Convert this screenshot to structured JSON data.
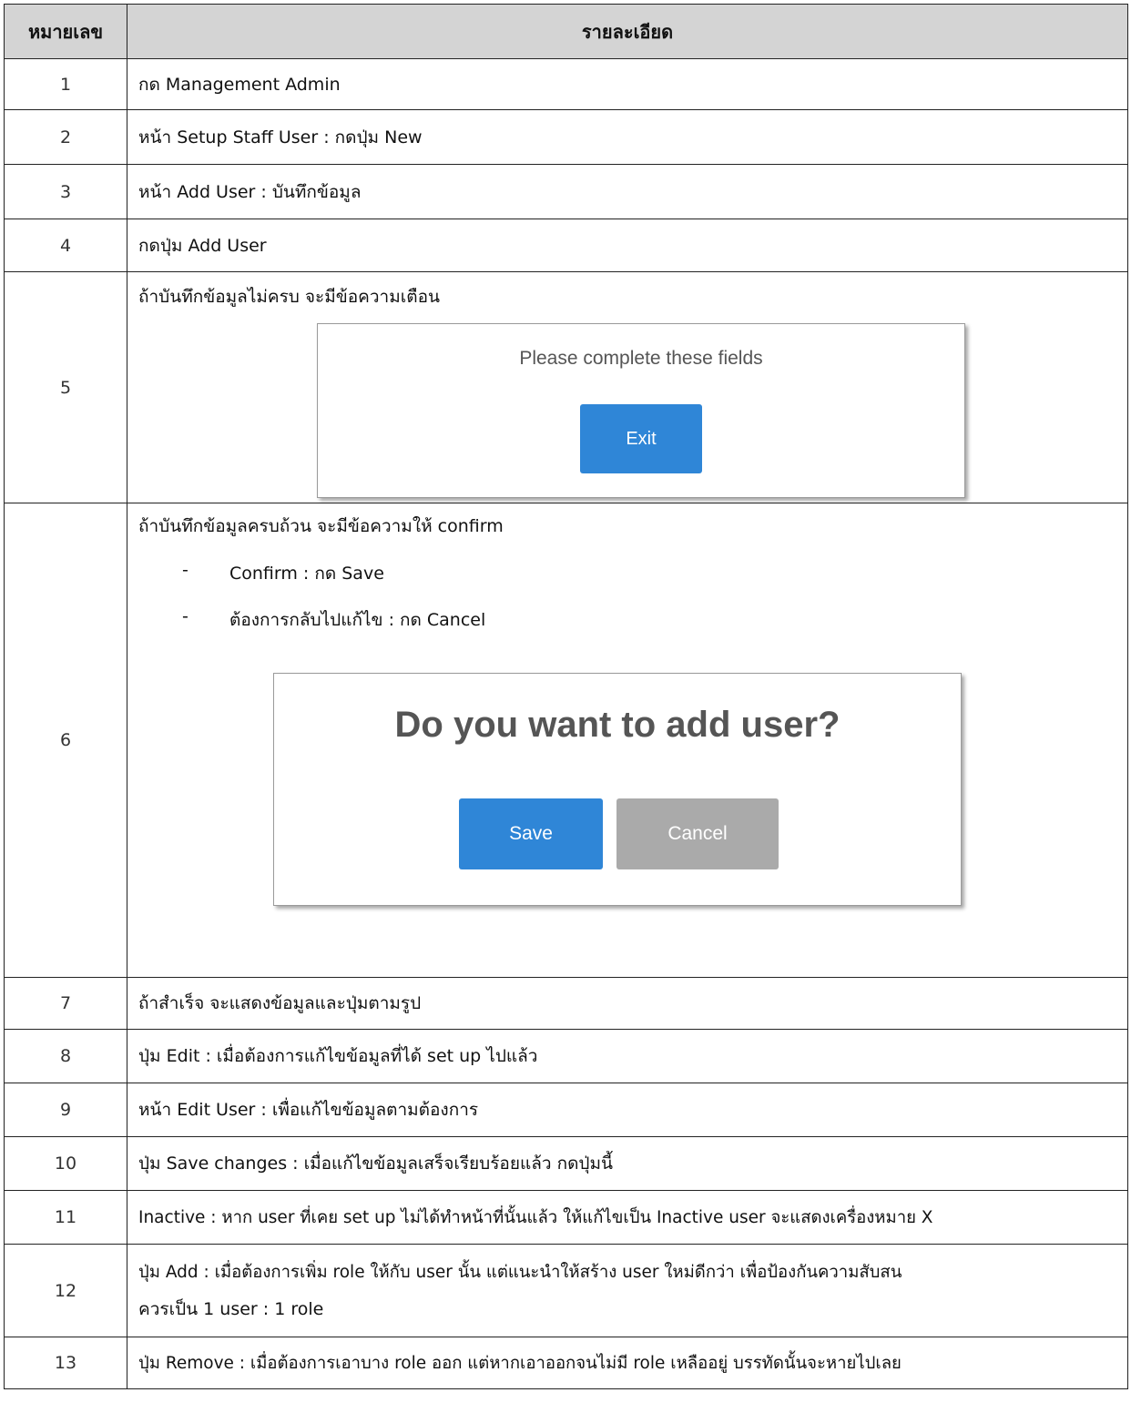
{
  "header": {
    "number": "หมายเลข",
    "detail": "รายละเอียด"
  },
  "rows": [
    {
      "num": "1",
      "text": "กด Management Admin"
    },
    {
      "num": "2",
      "text": "หน้า Setup Staff User : กดปุ่ม New"
    },
    {
      "num": "3",
      "text": "หน้า Add User : บันทึกข้อมูล"
    },
    {
      "num": "4",
      "text": "กดปุ่ม Add User"
    },
    {
      "num": "5",
      "text": "ถ้าบันทึกข้อมูลไม่ครบ จะมีข้อความเตือน",
      "dialog": {
        "message": "Please complete these fields",
        "exit_label": "Exit"
      }
    },
    {
      "num": "6",
      "text": "ถ้าบันทึกข้อมูลครบถ้วน จะมีข้อความให้ confirm",
      "bullets": [
        "Confirm : กด Save",
        "ต้องการกลับไปแก้ไข : กด Cancel"
      ],
      "bullet_marker": "-",
      "dialog": {
        "question": "Do you want to add user?",
        "save_label": "Save",
        "cancel_label": "Cancel"
      }
    },
    {
      "num": "7",
      "text": "ถ้าสำเร็จ จะแสดงข้อมูลและปุ่มตามรูป"
    },
    {
      "num": "8",
      "text": "ปุ่ม Edit : เมื่อต้องการแก้ไขข้อมูลที่ได้ set up ไปแล้ว"
    },
    {
      "num": "9",
      "text": "หน้า Edit User : เพื่อแก้ไขข้อมูลตามต้องการ"
    },
    {
      "num": "10",
      "text": "ปุ่ม Save changes : เมื่อแก้ไขข้อมูลเสร็จเรียบร้อยแล้ว กดปุ่มนี้"
    },
    {
      "num": "11",
      "text": "Inactive : หาก user ที่เคย set up ไม่ได้ทำหน้าที่นั้นแล้ว ให้แก้ไขเป็น Inactive user จะแสดงเครื่องหมาย X"
    },
    {
      "num": "12",
      "text_line1": "ปุ่ม Add : เมื่อต้องการเพิ่ม role ให้กับ user นั้น แต่แนะนำให้สร้าง user ใหม่ดีกว่า เพื่อป้องกันความสับสน",
      "text_line2": "ควรเป็น 1 user : 1 role"
    },
    {
      "num": "13",
      "text": "ปุ่ม Remove : เมื่อต้องการเอาบาง role ออก แต่หากเอาออกจนไม่มี role เหลืออยู่ บรรทัดนั้นจะหายไปเลย"
    }
  ],
  "colors": {
    "header_bg": "#d4d4d4",
    "primary_button": "#2f86d7",
    "secondary_button": "#aaaaaa",
    "border": "#222222"
  }
}
